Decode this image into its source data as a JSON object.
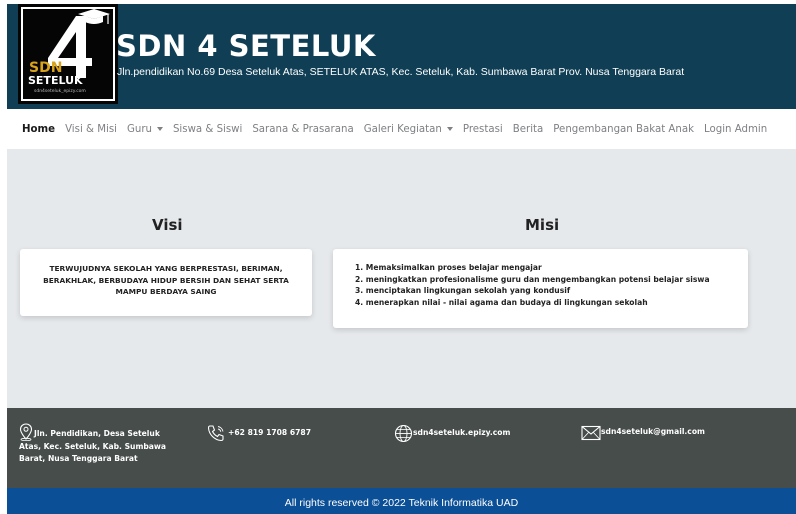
{
  "header": {
    "logo_text": "SDN 4 SETELUK",
    "title": "SDN 4 SETELUK",
    "address": "Jln.pendidikan No.69 Desa Seteluk Atas, SETELUK ATAS, Kec. Seteluk, Kab. Sumbawa Barat Prov. Nusa Tenggara Barat"
  },
  "nav": {
    "items": [
      {
        "label": "Home",
        "active": true,
        "dropdown": false
      },
      {
        "label": "Visi & Misi",
        "active": false,
        "dropdown": false
      },
      {
        "label": "Guru",
        "active": false,
        "dropdown": true
      },
      {
        "label": "Siswa & Siswi",
        "active": false,
        "dropdown": false
      },
      {
        "label": "Sarana & Prasarana",
        "active": false,
        "dropdown": false
      },
      {
        "label": "Galeri Kegiatan",
        "active": false,
        "dropdown": true
      },
      {
        "label": "Prestasi",
        "active": false,
        "dropdown": false
      },
      {
        "label": "Berita",
        "active": false,
        "dropdown": false
      },
      {
        "label": "Pengembangan Bakat Anak",
        "active": false,
        "dropdown": false
      },
      {
        "label": "Login Admin",
        "active": false,
        "dropdown": false
      }
    ]
  },
  "visi": {
    "heading": "Visi",
    "text": "TERWUJUDNYA SEKOLAH YANG BERPRESTASI, BERIMAN, BERAKHLAK, BERBUDAYA HIDUP BERSIH DAN SEHAT SERTA MAMPU BERDAYA SAING"
  },
  "misi": {
    "heading": "Misi",
    "items": [
      "1. Memaksimalkan proses belajar mengajar",
      "2. meningkatkan profesionalisme guru dan mengembangkan potensi belajar siswa",
      "3. menciptakan lingkungan sekolah yang kondusif",
      "4. menerapkan nilai - nilai agama dan budaya di lingkungan sekolah"
    ]
  },
  "footer": {
    "address": "Jln. Pendidikan, Desa Seteluk Atas, Kec. Seteluk, Kab. Sumbawa Barat, Nusa Tenggara Barat",
    "phone": "+62 819 1708 6787",
    "website": "sdn4seteluk.epizy.com",
    "email": "sdn4seteluk@gmail.com",
    "copyright": "All rights reserved © 2022 Teknik Informatika UAD"
  },
  "colors": {
    "header_bg": "#103f55",
    "main_bg": "#e6e9ec",
    "footer_bg": "#464d4a",
    "copyright_bg": "#0b4f96"
  }
}
